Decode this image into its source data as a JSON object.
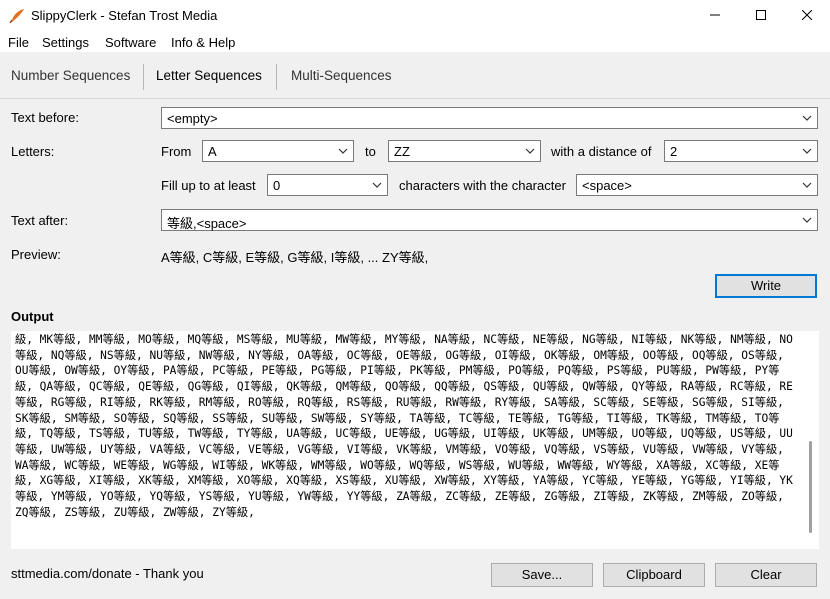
{
  "window": {
    "title": "SlippyClerk - Stefan Trost Media",
    "minimize": "—",
    "maximize": "☐",
    "close": "✕"
  },
  "menu": [
    "File",
    "Settings",
    "Software",
    "Info & Help"
  ],
  "tabs": [
    {
      "label": "Number Sequences",
      "active": false
    },
    {
      "label": "Letter Sequences",
      "active": true
    },
    {
      "label": "Multi-Sequences",
      "active": false
    }
  ],
  "form": {
    "text_before_label": "Text before:",
    "text_before_value": "<empty>",
    "letters_label": "Letters:",
    "from_label": "From",
    "from_value": "A",
    "to_label": "to",
    "to_value": "ZZ",
    "distance_label": "with a distance of",
    "distance_value": "2",
    "fill_label": "Fill up to at least",
    "fill_value": "0",
    "chars_label": "characters with the character",
    "chars_value": "<space>",
    "text_after_label": "Text after:",
    "text_after_value": "等級,<space>",
    "preview_label": "Preview:",
    "preview_value": "A等級, C等級, E等級, G等級, I等級, ... ZY等級,"
  },
  "write_button": "Write",
  "output_label": "Output",
  "output_text": "級, MK等級, MM等級, MO等級, MQ等級, MS等級, MU等級, MW等級, MY等級, NA等級, NC等級, NE等級, NG等級, NI等級, NK等級, NM等級, NO等級, NQ等級, NS等級, NU等級, NW等級, NY等級, OA等級, OC等級, OE等級, OG等級, OI等級, OK等級, OM等級, OO等級, OQ等級, OS等級, OU等級, OW等級, OY等級, PA等級, PC等級, PE等級, PG等級, PI等級, PK等級, PM等級, PO等級, PQ等級, PS等級, PU等級, PW等級, PY等級, QA等級, QC等級, QE等級, QG等級, QI等級, QK等級, QM等級, QO等級, QQ等級, QS等級, QU等級, QW等級, QY等級, RA等級, RC等級, RE等級, RG等級, RI等級, RK等級, RM等級, RO等級, RQ等級, RS等級, RU等級, RW等級, RY等級, SA等級, SC等級, SE等級, SG等級, SI等級, SK等級, SM等級, SO等級, SQ等級, SS等級, SU等級, SW等級, SY等級, TA等級, TC等級, TE等級, TG等級, TI等級, TK等級, TM等級, TO等級, TQ等級, TS等級, TU等級, TW等級, TY等級, UA等級, UC等級, UE等級, UG等級, UI等級, UK等級, UM等級, UO等級, UQ等級, US等級, UU等級, UW等級, UY等級, VA等級, VC等級, VE等級, VG等級, VI等級, VK等級, VM等級, VO等級, VQ等級, VS等級, VU等級, VW等級, VY等級, WA等級, WC等級, WE等級, WG等級, WI等級, WK等級, WM等級, WO等級, WQ等級, WS等級, WU等級, WW等級, WY等級, XA等級, XC等級, XE等級, XG等級, XI等級, XK等級, XM等級, XO等級, XQ等級, XS等級, XU等級, XW等級, XY等級, YA等級, YC等級, YE等級, YG等級, YI等級, YK等級, YM等級, YO等級, YQ等級, YS等級, YU等級, YW等級, YY等級, ZA等級, ZC等級, ZE等級, ZG等級, ZI等級, ZK等級, ZM等級, ZO等級, ZQ等級, ZS等級, ZU等級, ZW等級, ZY等級,",
  "footer": {
    "donate_text": "sttmedia.com/donate - Thank you",
    "save_button": "Save...",
    "clipboard_button": "Clipboard",
    "clear_button": "Clear"
  },
  "icons": {
    "app": "quill-icon",
    "dropdown": "chevron-down-icon"
  },
  "colors": {
    "accent": "#0078d7"
  }
}
